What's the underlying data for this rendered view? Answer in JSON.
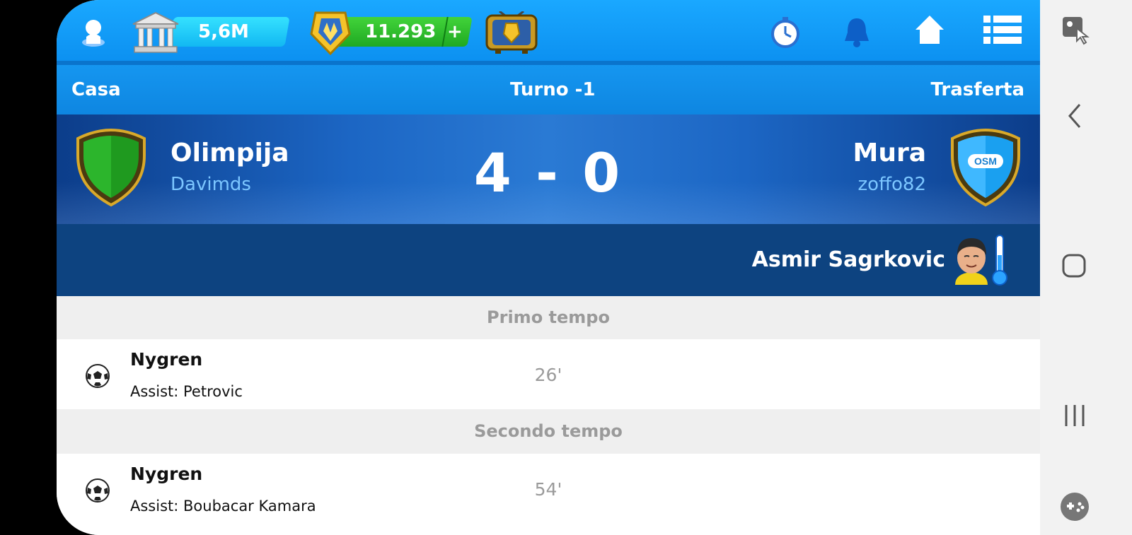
{
  "topbar": {
    "money": "5,6M",
    "coins": "11.293",
    "coins_plus": "+",
    "icons": [
      "profile-icon",
      "bank-icon",
      "coin-shield-icon",
      "tv-icon",
      "stopwatch-icon",
      "bell-icon",
      "home-icon",
      "menu-icon"
    ]
  },
  "subbar": {
    "home_label": "Casa",
    "round_label": "Turno -1",
    "away_label": "Trasferta"
  },
  "match": {
    "home_team": "Olimpija",
    "home_manager": "Davimds",
    "away_team": "Mura",
    "away_manager": "zoffo82",
    "score": "4 - 0",
    "away_crest_text": "OSM"
  },
  "info": {
    "player_name": "Asmir Sagrkovic"
  },
  "periods": [
    {
      "label": "Primo tempo",
      "events": [
        {
          "scorer": "Nygren",
          "assist": "Assist: Petrovic",
          "minute": "26'"
        }
      ]
    },
    {
      "label": "Secondo tempo",
      "events": [
        {
          "scorer": "Nygren",
          "assist": "Assist: Boubacar Kamara",
          "minute": "54'"
        }
      ]
    }
  ],
  "colors": {
    "topbar": "#0b8ff0",
    "match_bg": "#1c66c4",
    "home_crest": "#1e9b1e",
    "away_crest": "#1aa0f0",
    "manager_text": "#7cc6ff",
    "period_bg": "#efefef"
  },
  "android_nav": [
    "screen-capture-icon",
    "back-icon",
    "home-circle-icon",
    "recents-icon",
    "game-tools-icon"
  ]
}
